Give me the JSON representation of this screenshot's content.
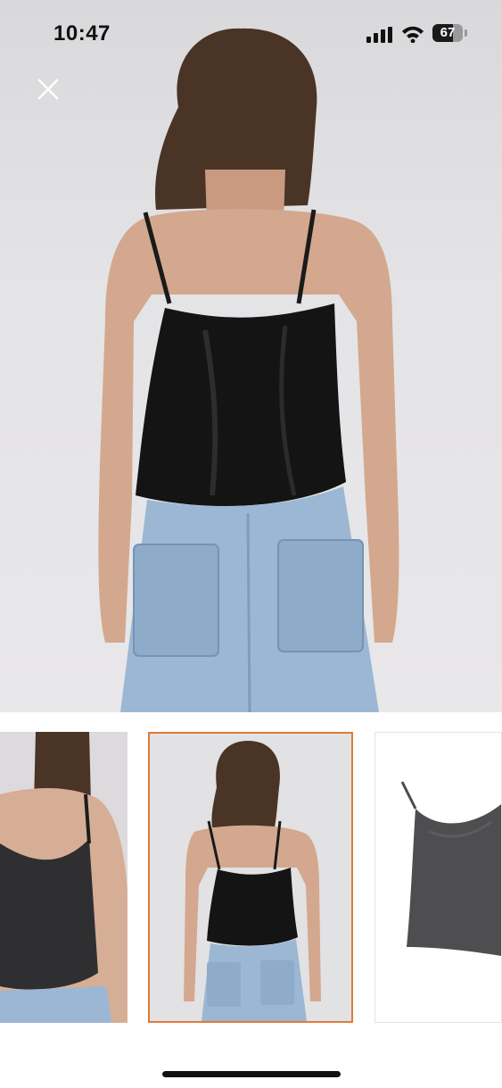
{
  "status_bar": {
    "time": "10:47",
    "battery_label": "67",
    "battery_level": 0.67,
    "icons": [
      "cellular-signal-icon",
      "wifi-icon",
      "battery-icon"
    ]
  },
  "viewer": {
    "close_icon": "close-icon",
    "main_image": "product-photo-back-view",
    "selected_index": 1,
    "thumbnails": [
      {
        "name": "front-view"
      },
      {
        "name": "back-view"
      },
      {
        "name": "product-flat-view"
      }
    ]
  },
  "colors": {
    "selected_border": "#e07a3a",
    "background": "#ffffff"
  }
}
